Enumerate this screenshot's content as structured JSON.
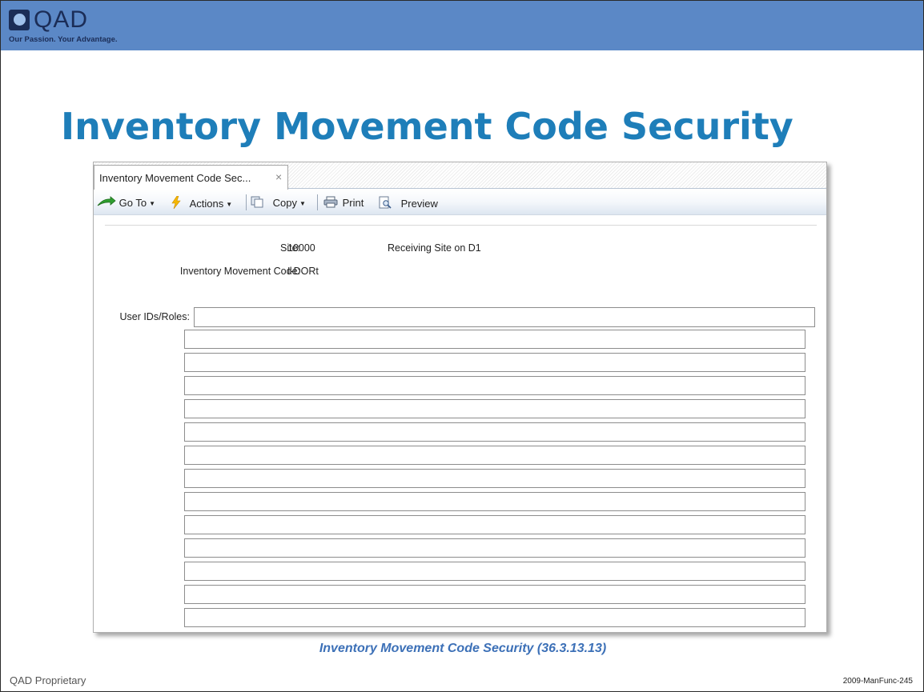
{
  "branding": {
    "logo_text": "QAD",
    "tagline": "Our Passion. Your Advantage."
  },
  "slide": {
    "title": "Inventory Movement Code Security",
    "caption": "Inventory Movement Code Security (36.3.13.13)",
    "footer_left": "QAD Proprietary",
    "footer_right": "2009-ManFunc-245"
  },
  "window": {
    "tab_label": "Inventory Movement Code Sec...",
    "tab_close": "×",
    "toolbar": {
      "goto_label": "Go To",
      "actions_label": "Actions",
      "copy_label": "Copy",
      "print_label": "Print",
      "preview_label": "Preview"
    },
    "form": {
      "site_label": "Site:",
      "site_value": "10000",
      "site_description": "Receiving Site on D1",
      "imc_label": "Inventory Movement Code:",
      "imc_value": "I-DORt",
      "users_label": "User IDs/Roles:",
      "users_value": "",
      "list_rows": [
        "",
        "",
        "",
        "",
        "",
        "",
        "",
        "",
        "",
        "",
        "",
        "",
        ""
      ]
    }
  },
  "colors": {
    "banner": "#5b88c6",
    "title": "#1e7eb9",
    "caption": "#3c70b7"
  }
}
